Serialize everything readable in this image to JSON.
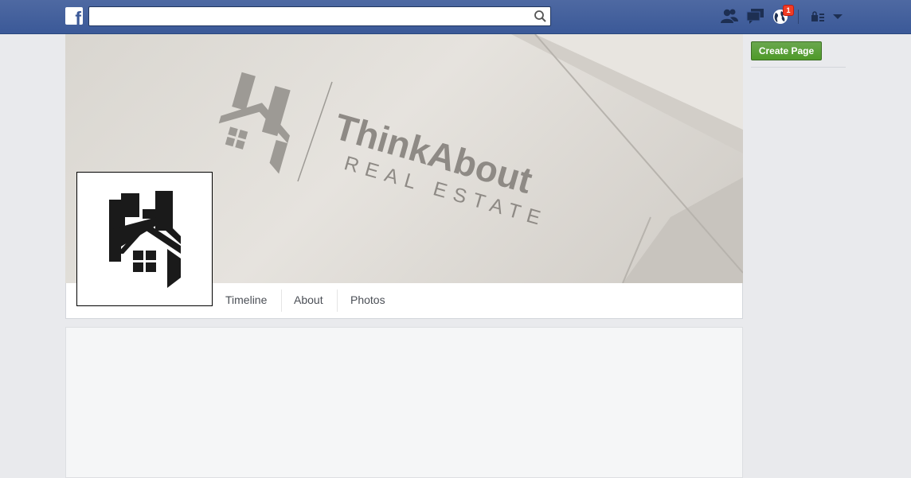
{
  "topbar": {
    "logo_letter": "f",
    "search": {
      "value": "",
      "placeholder": ""
    },
    "notification_count": "1",
    "icons": [
      "friend-requests-icon",
      "messages-icon",
      "notifications-globe-icon",
      "privacy-lock-icon",
      "account-menu-chevron-icon"
    ]
  },
  "cover": {
    "brand_name": "ThinkAbout",
    "brand_tagline": "REAL ESTATE"
  },
  "tabs": [
    {
      "label": "Timeline"
    },
    {
      "label": "About"
    },
    {
      "label": "Photos"
    }
  ],
  "right_column": {
    "create_page_label": "Create Page"
  },
  "colors": {
    "topbar": "#3b5998",
    "create_button": "#4f9a29",
    "badge": "#f03d25",
    "background": "#e9eaed"
  }
}
